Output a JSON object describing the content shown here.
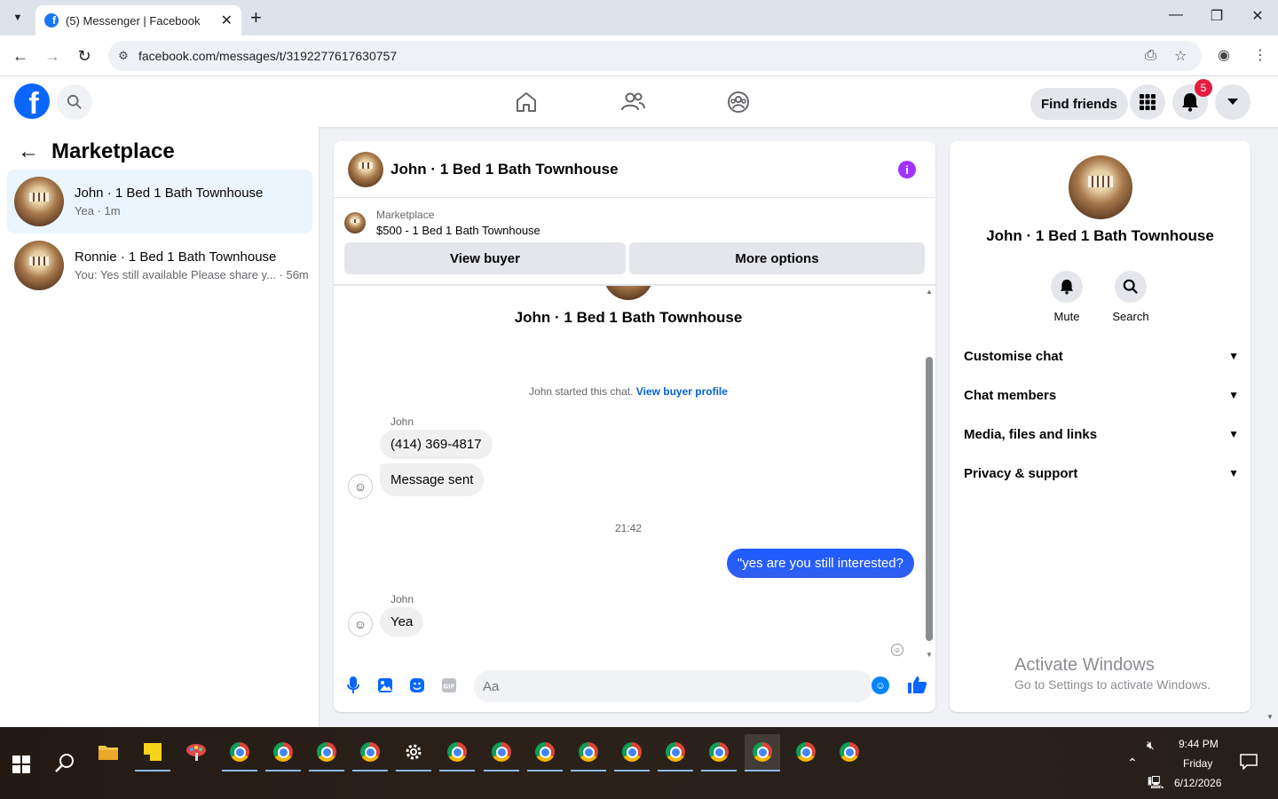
{
  "browser": {
    "tab_title": "(5) Messenger | Facebook",
    "url": "facebook.com/messages/t/3192277617630757",
    "new_tab": "+",
    "tab_close": "✕",
    "minimize": "—",
    "restore": "❐",
    "close": "✕"
  },
  "header": {
    "logo": "f",
    "find_friends": "Find friends",
    "notifications_count": "5"
  },
  "left": {
    "title": "Marketplace",
    "conversations": [
      {
        "name": "John · 1 Bed 1 Bath Townhouse",
        "preview": "Yea · 1m",
        "active": true
      },
      {
        "name": "Ronnie · 1 Bed 1 Bath Townhouse",
        "preview": "You: Yes still available Please share y... · 56m",
        "active": false
      }
    ]
  },
  "chat": {
    "title": "John · 1 Bed 1 Bath Townhouse",
    "marketplace_label": "Marketplace",
    "listing": "$500 - 1 Bed 1 Bath Townhouse",
    "view_buyer": "View buyer",
    "more_options": "More options",
    "profile_name": "John · 1 Bed 1 Bath Townhouse",
    "started_text": "John started this chat.",
    "view_buyer_profile": "View buyer profile",
    "messages": [
      {
        "sender": "John",
        "text": "(414) 369-4817"
      },
      {
        "text": "Message sent"
      },
      {
        "time": "21:42"
      },
      {
        "text": "\"yes are you still interested?",
        "outgoing": true
      },
      {
        "sender": "John",
        "text": "Yea"
      }
    ],
    "composer_placeholder": "Aa"
  },
  "right": {
    "name": "John · 1 Bed 1 Bath Townhouse",
    "mute": "Mute",
    "search": "Search",
    "items": [
      "Customise chat",
      "Chat members",
      "Media, files and links",
      "Privacy & support"
    ],
    "watermark_title": "Activate Windows",
    "watermark_sub": "Go to Settings to activate Windows."
  },
  "taskbar": {
    "time": "9:44 PM",
    "day": "Friday",
    "date": "6/12/2026"
  },
  "colors": {
    "fb_blue": "#0866ff",
    "bubble_out": "#2f5ff0",
    "badge": "#e41e3f"
  }
}
